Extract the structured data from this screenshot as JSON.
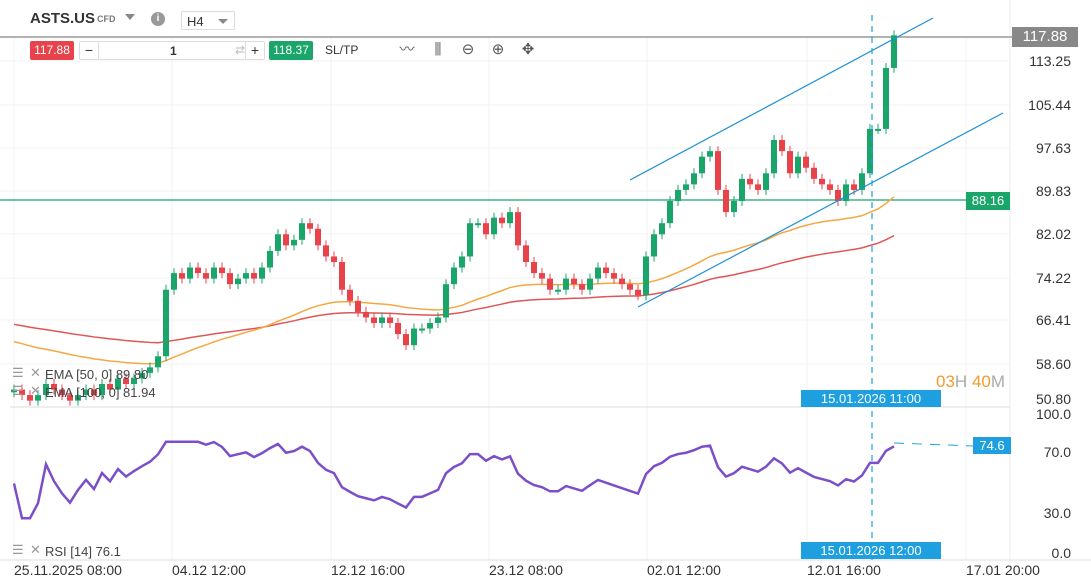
{
  "header": {
    "symbol": "ASTS.US",
    "type": "CFD",
    "timeframe": "H4"
  },
  "trade": {
    "sell_price": "117.88",
    "quantity": "1",
    "buy_price": "118.37",
    "sltp_label": "SL/TP",
    "minus": "−",
    "plus": "+"
  },
  "tools": [
    "line-chart-icon",
    "candles-icon",
    "zoom-out-icon",
    "zoom-in-icon",
    "move-icon"
  ],
  "price_axis": [
    "113.25",
    "105.44",
    "97.63",
    "89.83",
    "82.02",
    "74.22",
    "66.41",
    "58.60",
    "50.80"
  ],
  "rsi_axis": [
    "100.0",
    "70.0",
    "30.0",
    "0.0"
  ],
  "time_axis": [
    "25.11.2025 08:00",
    "04.12 12:00",
    "12.12 16:00",
    "23.12 08:00",
    "02.01 12:00",
    "12.01 16:00",
    "17.01 20:00"
  ],
  "current_price": "117.88",
  "level_price": "88.16",
  "crosshair_time_top": "15.01.2026 11:00",
  "crosshair_time_bottom": "15.01.2026 12:00",
  "rsi_value": "74.6",
  "timer": {
    "hours": "03",
    "h": "H",
    "minutes": "40",
    "m": "M"
  },
  "indicators": {
    "ema50": "EMA [50, 0] 89.80",
    "ema100": "EMA [100, 0] 81.94",
    "rsi": "RSI [14] 76.1"
  },
  "colors": {
    "up": "#1aa56b",
    "down": "#e8424b",
    "ema50": "#f5a742",
    "ema100": "#e05555",
    "rsi": "#7b4fc9",
    "channel": "#1e90d6",
    "level": "#1aa56b",
    "cross": "#1ea0e0"
  },
  "chart_data": {
    "type": "candlestick",
    "closes": [
      54,
      53,
      52,
      53,
      55,
      54,
      53,
      52,
      53,
      54,
      53,
      55,
      54,
      56,
      55,
      56,
      57,
      58,
      60,
      72,
      75,
      74,
      76,
      75,
      74,
      76,
      75,
      73,
      74,
      75,
      74,
      76,
      79,
      82,
      80,
      81,
      84,
      83,
      80,
      78,
      77,
      72,
      70,
      68,
      67,
      66,
      67,
      66,
      64,
      62,
      65,
      65,
      66,
      67,
      73,
      76,
      78,
      84,
      84,
      82,
      85,
      84,
      86,
      80,
      77,
      75,
      74,
      72,
      72,
      74,
      73,
      72,
      74,
      76,
      75,
      74,
      73,
      72,
      71,
      78,
      82,
      84,
      88,
      90,
      91,
      93,
      96,
      97,
      90,
      86,
      88,
      92,
      91,
      90,
      93,
      99,
      97,
      93,
      96,
      94,
      92,
      91,
      90,
      88,
      91,
      90,
      93,
      101,
      101,
      112,
      117.88
    ],
    "ema50_seed": 63,
    "ema100_seed": 66,
    "ylim": [
      50.8,
      117.88
    ],
    "rsi_ylim": [
      0,
      100
    ]
  }
}
